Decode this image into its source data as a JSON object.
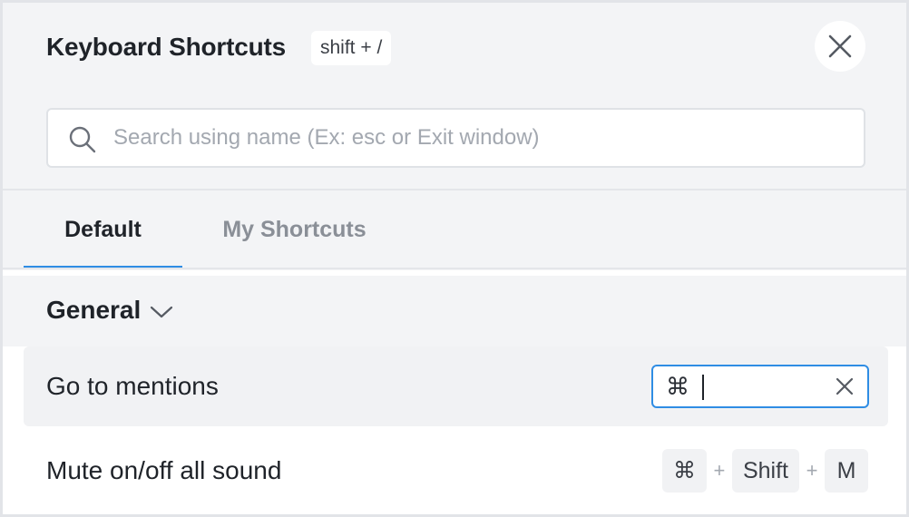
{
  "dialog": {
    "title": "Keyboard Shortcuts",
    "title_shortcut": "shift + /",
    "close_icon": "close-icon"
  },
  "search": {
    "placeholder": "Search using name (Ex: esc or Exit window)",
    "value": "",
    "icon": "search-icon"
  },
  "tabs": [
    {
      "label": "Default",
      "active": true
    },
    {
      "label": "My Shortcuts",
      "active": false
    }
  ],
  "section": {
    "title": "General",
    "icon": "chevron-down-icon",
    "expanded": true
  },
  "shortcuts": [
    {
      "label": "Go to mentions",
      "editing": true,
      "recorded_keys": [
        "⌘"
      ]
    },
    {
      "label": "Mute on/off all sound",
      "editing": false,
      "keys": [
        "⌘",
        "Shift",
        "M"
      ],
      "separator": "+"
    }
  ],
  "colors": {
    "accent": "#2f8de4",
    "panel_bg": "#f3f4f6",
    "text": "#1f2329",
    "muted": "#8a8f97"
  }
}
